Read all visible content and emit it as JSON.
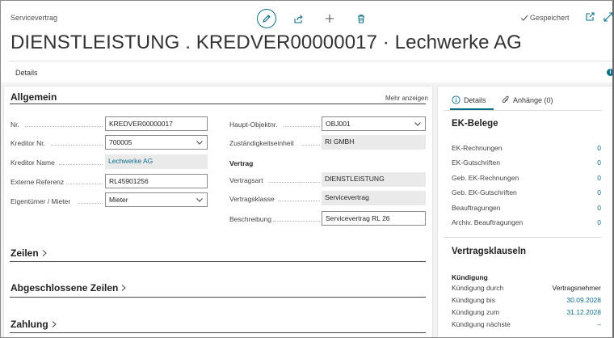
{
  "header": {
    "caption": "Servicevertrag",
    "saved_status": "Gespeichert",
    "title": "DIENSTLEISTUNG . KREDVER00000017 · Lechwerke AG",
    "details_tab": "Details",
    "info_badge": "i"
  },
  "allgemein": {
    "title": "Allgemein",
    "more_link": "Mehr anzeigen",
    "left_fields": [
      {
        "label": "Nr.",
        "value": "KREDVER00000017"
      },
      {
        "label": "Kreditor Nr.",
        "value": "700005"
      },
      {
        "label": "Kreditor Name",
        "value": "Lechwerke AG"
      },
      {
        "label": "Externe Referenz",
        "value": "RL45901256"
      },
      {
        "label": "Eigentümer / Mieter",
        "value": "Mieter"
      }
    ],
    "right_fields": [
      {
        "label": "Haupt-Objektnr.",
        "value": "OBJ001"
      },
      {
        "label": "Zuständigkeitseinheit",
        "value": "RI GMBH"
      }
    ],
    "vertrag_group": "Vertrag",
    "vertrag_fields": [
      {
        "label": "Vertragsart",
        "value": "DIENSTLEISTUNG"
      },
      {
        "label": "Vertragsklasse",
        "value": "Servicevertrag"
      },
      {
        "label": "Beschreibung",
        "value": "Servicevertrag RL 26"
      }
    ]
  },
  "sections": [
    {
      "title": "Zeilen"
    },
    {
      "title": "Abgeschlossene Zeilen"
    },
    {
      "title": "Zahlung"
    }
  ],
  "factbox": {
    "tabs": [
      {
        "label": "Details",
        "icon": "info-icon"
      },
      {
        "label": "Anhänge (0)",
        "icon": "paperclip-icon"
      }
    ],
    "ek_title": "EK-Belege",
    "ek_rows": [
      {
        "label": "EK-Rechnungen",
        "value": "0"
      },
      {
        "label": "EK-Gutschriften",
        "value": "0"
      },
      {
        "label": "Geb. EK-Rechnungen",
        "value": "0"
      },
      {
        "label": "Geb. EK-Gutschriften",
        "value": "0"
      },
      {
        "label": "Beauftragungen",
        "value": "0"
      },
      {
        "label": "Archiv. Beauftragungen",
        "value": "0"
      }
    ],
    "clauses_title": "Vertragsklauseln",
    "kuendigung_group": "Kündigung",
    "kuendigung_rows": [
      {
        "label": "Kündigung durch",
        "value": "Vertragsnehmer"
      },
      {
        "label": "Kündigung bis",
        "value": "30.09.2028"
      },
      {
        "label": "Kündigung zum",
        "value": "31.12.2028"
      },
      {
        "label": "Kündigung nächste",
        "value": "–"
      }
    ]
  },
  "colors": {
    "accent": "#0e6f8c"
  }
}
